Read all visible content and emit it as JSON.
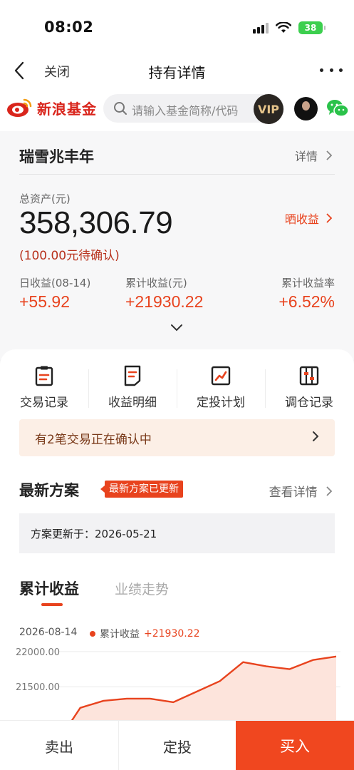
{
  "status": {
    "time": "08:02",
    "battery": "38"
  },
  "nav": {
    "close_label": "关闭",
    "title": "持有详情"
  },
  "brand": {
    "name": "新浪基金",
    "search_placeholder": "请输入基金简称/代码",
    "vip_label": "VIP"
  },
  "fund": {
    "name": "瑞雪兆丰年",
    "detail_link": "详情",
    "asset_label": "总资产(元)",
    "asset_value": "358,306.79",
    "show_profit_link": "晒收益",
    "pending_text": "(100.00元待确认)",
    "metrics": [
      {
        "label": "日收益(08-14)",
        "value": "+55.92"
      },
      {
        "label": "累计收益(元)",
        "value": "+21930.22"
      },
      {
        "label": "累计收益率",
        "value": "+6.52%"
      }
    ]
  },
  "actions": [
    {
      "label": "交易记录",
      "icon": "clipboard-icon"
    },
    {
      "label": "收益明细",
      "icon": "document-icon"
    },
    {
      "label": "定投计划",
      "icon": "trend-chart-icon"
    },
    {
      "label": "调仓记录",
      "icon": "adjust-icon"
    }
  ],
  "confirm_banner": {
    "text": "有2笔交易正在确认中"
  },
  "plan": {
    "title": "最新方案",
    "badge": "最新方案已更新",
    "detail_link": "查看详情",
    "updated_text": "方案更新于：2026-05-21"
  },
  "tabs": {
    "active": "累计收益",
    "inactive": "业绩走势"
  },
  "chart_header": {
    "date": "2026-08-14",
    "legend_name": "累计收益",
    "legend_value": "+21930.22"
  },
  "chart_data": {
    "type": "area",
    "ytick_labels": [
      "22000.00",
      "21500.00"
    ],
    "ylim": [
      20600,
      22100
    ],
    "x": [
      1,
      2,
      3,
      4,
      5,
      6,
      7,
      8,
      9,
      10,
      11,
      12,
      13
    ],
    "series": [
      {
        "values": [
          20700,
          21200,
          21300,
          21330,
          21330,
          21280,
          21430,
          21580,
          21850,
          21790,
          21750,
          21880,
          21930
        ]
      }
    ],
    "colors": {
      "line": "#e8431e",
      "fill": "#fde4dc"
    },
    "grid": true
  },
  "bottom": {
    "sell": "卖出",
    "fixed": "定投",
    "buy": "买入"
  }
}
